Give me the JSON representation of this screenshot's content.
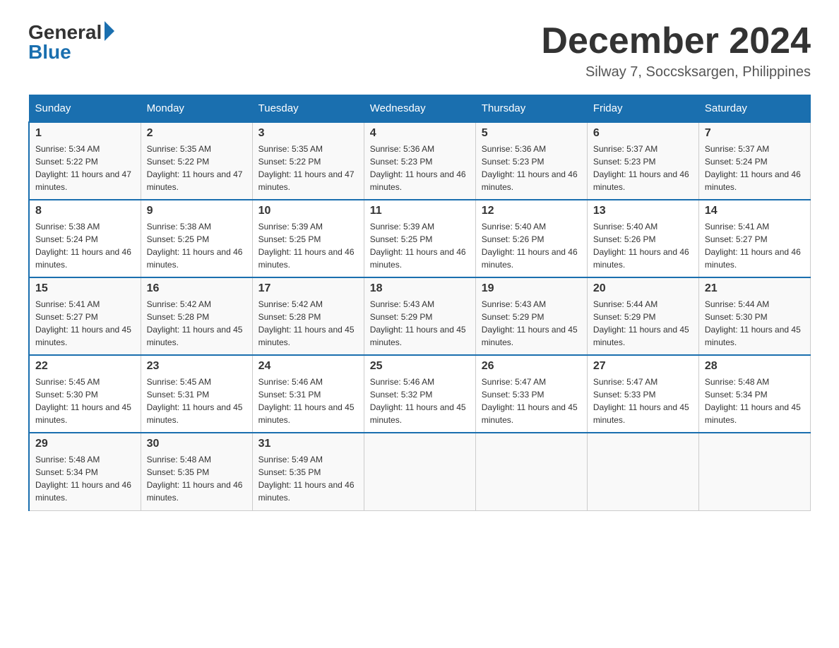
{
  "header": {
    "logo_general": "General",
    "logo_blue": "Blue",
    "month_title": "December 2024",
    "location": "Silway 7, Soccsksargen, Philippines"
  },
  "days_of_week": [
    "Sunday",
    "Monday",
    "Tuesday",
    "Wednesday",
    "Thursday",
    "Friday",
    "Saturday"
  ],
  "weeks": [
    [
      {
        "num": "1",
        "sunrise": "5:34 AM",
        "sunset": "5:22 PM",
        "daylight": "11 hours and 47 minutes."
      },
      {
        "num": "2",
        "sunrise": "5:35 AM",
        "sunset": "5:22 PM",
        "daylight": "11 hours and 47 minutes."
      },
      {
        "num": "3",
        "sunrise": "5:35 AM",
        "sunset": "5:22 PM",
        "daylight": "11 hours and 47 minutes."
      },
      {
        "num": "4",
        "sunrise": "5:36 AM",
        "sunset": "5:23 PM",
        "daylight": "11 hours and 46 minutes."
      },
      {
        "num": "5",
        "sunrise": "5:36 AM",
        "sunset": "5:23 PM",
        "daylight": "11 hours and 46 minutes."
      },
      {
        "num": "6",
        "sunrise": "5:37 AM",
        "sunset": "5:23 PM",
        "daylight": "11 hours and 46 minutes."
      },
      {
        "num": "7",
        "sunrise": "5:37 AM",
        "sunset": "5:24 PM",
        "daylight": "11 hours and 46 minutes."
      }
    ],
    [
      {
        "num": "8",
        "sunrise": "5:38 AM",
        "sunset": "5:24 PM",
        "daylight": "11 hours and 46 minutes."
      },
      {
        "num": "9",
        "sunrise": "5:38 AM",
        "sunset": "5:25 PM",
        "daylight": "11 hours and 46 minutes."
      },
      {
        "num": "10",
        "sunrise": "5:39 AM",
        "sunset": "5:25 PM",
        "daylight": "11 hours and 46 minutes."
      },
      {
        "num": "11",
        "sunrise": "5:39 AM",
        "sunset": "5:25 PM",
        "daylight": "11 hours and 46 minutes."
      },
      {
        "num": "12",
        "sunrise": "5:40 AM",
        "sunset": "5:26 PM",
        "daylight": "11 hours and 46 minutes."
      },
      {
        "num": "13",
        "sunrise": "5:40 AM",
        "sunset": "5:26 PM",
        "daylight": "11 hours and 46 minutes."
      },
      {
        "num": "14",
        "sunrise": "5:41 AM",
        "sunset": "5:27 PM",
        "daylight": "11 hours and 46 minutes."
      }
    ],
    [
      {
        "num": "15",
        "sunrise": "5:41 AM",
        "sunset": "5:27 PM",
        "daylight": "11 hours and 45 minutes."
      },
      {
        "num": "16",
        "sunrise": "5:42 AM",
        "sunset": "5:28 PM",
        "daylight": "11 hours and 45 minutes."
      },
      {
        "num": "17",
        "sunrise": "5:42 AM",
        "sunset": "5:28 PM",
        "daylight": "11 hours and 45 minutes."
      },
      {
        "num": "18",
        "sunrise": "5:43 AM",
        "sunset": "5:29 PM",
        "daylight": "11 hours and 45 minutes."
      },
      {
        "num": "19",
        "sunrise": "5:43 AM",
        "sunset": "5:29 PM",
        "daylight": "11 hours and 45 minutes."
      },
      {
        "num": "20",
        "sunrise": "5:44 AM",
        "sunset": "5:29 PM",
        "daylight": "11 hours and 45 minutes."
      },
      {
        "num": "21",
        "sunrise": "5:44 AM",
        "sunset": "5:30 PM",
        "daylight": "11 hours and 45 minutes."
      }
    ],
    [
      {
        "num": "22",
        "sunrise": "5:45 AM",
        "sunset": "5:30 PM",
        "daylight": "11 hours and 45 minutes."
      },
      {
        "num": "23",
        "sunrise": "5:45 AM",
        "sunset": "5:31 PM",
        "daylight": "11 hours and 45 minutes."
      },
      {
        "num": "24",
        "sunrise": "5:46 AM",
        "sunset": "5:31 PM",
        "daylight": "11 hours and 45 minutes."
      },
      {
        "num": "25",
        "sunrise": "5:46 AM",
        "sunset": "5:32 PM",
        "daylight": "11 hours and 45 minutes."
      },
      {
        "num": "26",
        "sunrise": "5:47 AM",
        "sunset": "5:33 PM",
        "daylight": "11 hours and 45 minutes."
      },
      {
        "num": "27",
        "sunrise": "5:47 AM",
        "sunset": "5:33 PM",
        "daylight": "11 hours and 45 minutes."
      },
      {
        "num": "28",
        "sunrise": "5:48 AM",
        "sunset": "5:34 PM",
        "daylight": "11 hours and 45 minutes."
      }
    ],
    [
      {
        "num": "29",
        "sunrise": "5:48 AM",
        "sunset": "5:34 PM",
        "daylight": "11 hours and 46 minutes."
      },
      {
        "num": "30",
        "sunrise": "5:48 AM",
        "sunset": "5:35 PM",
        "daylight": "11 hours and 46 minutes."
      },
      {
        "num": "31",
        "sunrise": "5:49 AM",
        "sunset": "5:35 PM",
        "daylight": "11 hours and 46 minutes."
      },
      null,
      null,
      null,
      null
    ]
  ],
  "labels": {
    "sunrise": "Sunrise:",
    "sunset": "Sunset:",
    "daylight": "Daylight:"
  }
}
